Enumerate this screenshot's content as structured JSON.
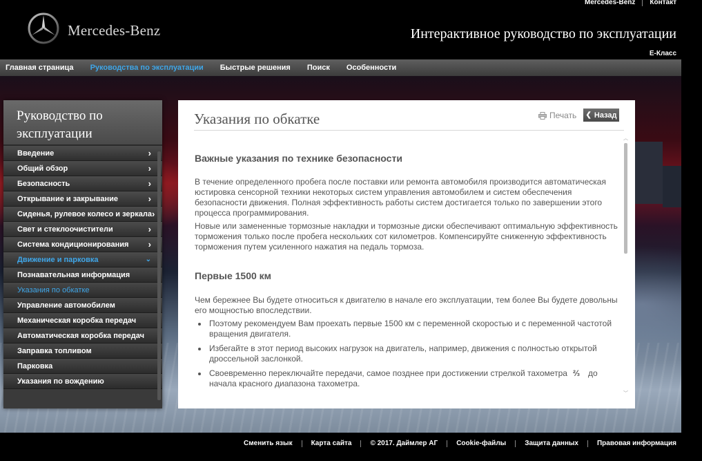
{
  "header": {
    "util_links": [
      "Mercedes-Benz",
      "Контакт"
    ],
    "brand": "Mercedes-Benz",
    "title": "Интерактивное руководство по эксплуатации",
    "class_label": "E-Класс"
  },
  "mainnav": {
    "items": [
      {
        "label": "Главная страница"
      },
      {
        "label": "Руководства по эксплуатации"
      },
      {
        "label": "Быстрые решения"
      },
      {
        "label": "Поиск"
      },
      {
        "label": "Особенности"
      }
    ],
    "active_color": "#3fa6e8"
  },
  "sidebar": {
    "title": "Руководство по эксплуатации",
    "items": [
      {
        "label": "Введение",
        "chev": "›"
      },
      {
        "label": "Общий обзор",
        "chev": "›"
      },
      {
        "label": "Безопасность",
        "chev": "›"
      },
      {
        "label": "Открывание и закрывание",
        "chev": "›"
      },
      {
        "label": "Сиденья, рулевое колесо и зеркала",
        "chev": "›"
      },
      {
        "label": "Свет и стеклоочистители",
        "chev": "›"
      },
      {
        "label": "Система кондиционирования",
        "chev": "›"
      },
      {
        "label": "Движение и парковка",
        "chev": "⌄"
      }
    ],
    "subitems": [
      {
        "label": "Познавательная информация"
      },
      {
        "label": "Указания по обкатке"
      },
      {
        "label": "Управление автомобилем"
      },
      {
        "label": "Механическая коробка передач"
      },
      {
        "label": "Автоматическая коробка передач"
      },
      {
        "label": "Заправка топливом"
      },
      {
        "label": "Парковка"
      },
      {
        "label": "Указания по вождению"
      }
    ]
  },
  "content": {
    "title": "Указания по обкатке",
    "print_label": "Печать",
    "back_label": "Назад",
    "section1_heading": "Важные указания по технике безопасности",
    "section1_p1": "В течение определенного пробега после поставки или ремонта автомобиля производится автоматическая юстировка сенсорной техники некоторых систем управления автомобилем и систем обеспечения безопасности движения. Полная эффективность работы систем достигается только по завершении этого процесса программирования.",
    "section1_p2": "Новые или замененные тормозные накладки и тормозные диски обеспечивают оптимальную эффективность торможения только после пробега нескольких сот километров. Компенсируйте сниженную эффективность торможения путем усиленного нажатия на педаль тормоза.",
    "section2_heading": "Первые 1500 км",
    "section2_intro": "Чем бережнее Вы будете относиться к двигателю в начале его эксплуатации, тем более Вы будете довольны его мощностью впоследствии.",
    "bullet1": "Поэтому рекомендуем Вам проехать первые 1500 км с переменной скоростью и с переменной частотой вращения двигателя.",
    "bullet2": "Избегайте в этот период высоких нагрузок на двигатель, например, движения с полностью открытой дроссельной заслонкой.",
    "bullet3_a": "Своевременно переключайте передачи, самое позднее при достижении стрелкой тахометра",
    "bullet3_frac": "⅔",
    "bullet3_b": "до начала красного диапазона тахометра."
  },
  "footer": {
    "links": [
      "Сменить язык",
      "Карта сайта",
      "© 2017. Даймлер АГ",
      "Cookie-файлы",
      "Защита данных",
      "Правовая информация"
    ]
  }
}
